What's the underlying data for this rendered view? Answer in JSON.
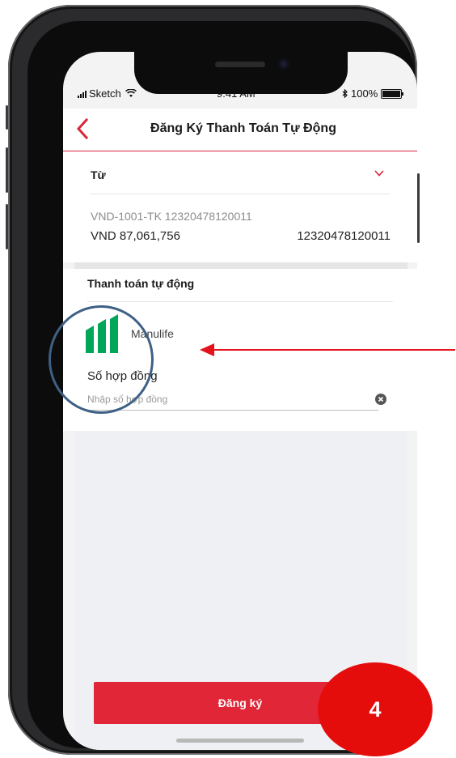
{
  "status_bar": {
    "carrier": "Sketch",
    "time": "9:41 AM",
    "battery": "100%"
  },
  "header": {
    "title": "Đăng Ký Thanh Toán Tự Động",
    "back_icon": "chevron-left-icon"
  },
  "from_section": {
    "label": "Từ",
    "account_line": "VND-1001-TK 12320478120011",
    "amount": "VND 87,061,756",
    "account_number": "12320478120011"
  },
  "autopay_section": {
    "title": "Thanh toán tự động",
    "provider_name": "Manulife",
    "contract_label": "Số hợp đồng",
    "contract_placeholder": "Nhập số hợp đồng",
    "contract_value": ""
  },
  "actions": {
    "register_label": "Đăng ký"
  },
  "annotation": {
    "step_number": "4"
  },
  "colors": {
    "accent_red": "#d9263a",
    "button_red": "#e02637",
    "manulife_green": "#00a758",
    "annotation_blue": "#3f6085",
    "arrow_red": "#e3121b",
    "badge_red": "#e50c0c"
  }
}
